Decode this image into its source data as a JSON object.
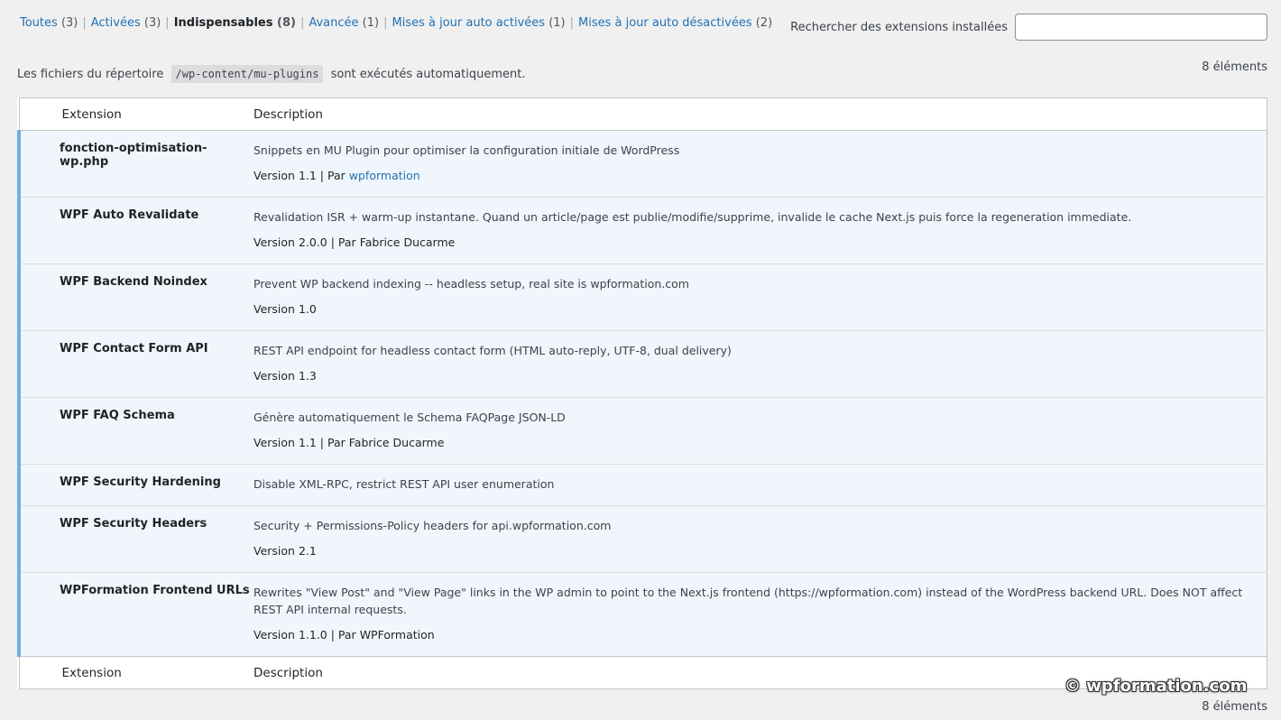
{
  "filters": [
    {
      "label": "Toutes",
      "count": "(3)",
      "current": false
    },
    {
      "label": "Activées",
      "count": "(3)",
      "current": false
    },
    {
      "label": "Indispensables",
      "count": "(8)",
      "current": true
    },
    {
      "label": "Avancée",
      "count": "(1)",
      "current": false
    },
    {
      "label": "Mises à jour auto activées",
      "count": "(1)",
      "current": false
    },
    {
      "label": "Mises à jour auto désactivées",
      "count": "(2)",
      "current": false
    }
  ],
  "search": {
    "label": "Rechercher des extensions installées",
    "value": ""
  },
  "notice": {
    "before": "Les fichiers du répertoire",
    "code": "/wp-content/mu-plugins",
    "after": "sont exécutés automatiquement."
  },
  "items_count": "8 éléments",
  "table": {
    "col_extension": "Extension",
    "col_description": "Description"
  },
  "plugins": [
    {
      "name": "fonction-optimisation-wp.php",
      "description": "Snippets en MU Plugin pour optimiser la configuration initiale de WordPress",
      "version": "Version 1.1",
      "by": "Par",
      "author": "wpformation",
      "author_link": true
    },
    {
      "name": "WPF Auto Revalidate",
      "description": "Revalidation ISR + warm-up instantane. Quand un article/page est publie/modifie/supprime, invalide le cache Next.js puis force la regeneration immediate.",
      "version": "Version 2.0.0",
      "by": "Par",
      "author": "Fabrice Ducarme",
      "author_link": false
    },
    {
      "name": "WPF Backend Noindex",
      "description": "Prevent WP backend indexing -- headless setup, real site is wpformation.com",
      "version": "Version 1.0",
      "by": "",
      "author": "",
      "author_link": false
    },
    {
      "name": "WPF Contact Form API",
      "description": "REST API endpoint for headless contact form (HTML auto-reply, UTF-8, dual delivery)",
      "version": "Version 1.3",
      "by": "",
      "author": "",
      "author_link": false
    },
    {
      "name": "WPF FAQ Schema",
      "description": "Génère automatiquement le Schema FAQPage JSON-LD",
      "version": "Version 1.1",
      "by": "Par",
      "author": "Fabrice Ducarme",
      "author_link": false
    },
    {
      "name": "WPF Security Hardening",
      "description": "Disable XML-RPC, restrict REST API user enumeration",
      "version": "",
      "by": "",
      "author": "",
      "author_link": false
    },
    {
      "name": "WPF Security Headers",
      "description": "Security + Permissions-Policy headers for api.wpformation.com",
      "version": "Version 2.1",
      "by": "",
      "author": "",
      "author_link": false
    },
    {
      "name": "WPFormation Frontend URLs",
      "description": "Rewrites \"View Post\" and \"View Page\" links in the WP admin to point to the Next.js frontend (https://wpformation.com) instead of the WordPress backend URL. Does NOT affect REST API internal requests.",
      "version": "Version 1.1.0",
      "by": "Par",
      "author": "WPFormation",
      "author_link": false
    }
  ],
  "watermark": "© wpformation.com",
  "colors": {
    "link": "#2271b1",
    "active_border": "#72aee6",
    "row_bg": "#f0f6fc"
  }
}
